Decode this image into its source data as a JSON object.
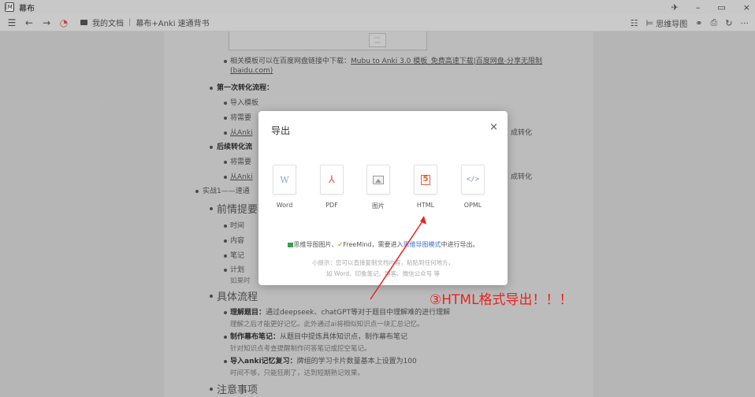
{
  "window": {
    "title": "幕布",
    "app_icon": "[M]",
    "pin": "✈",
    "minimize": "–",
    "maximize": "▭",
    "close": "×"
  },
  "toolbar": {
    "menu": "☰",
    "back": "←",
    "forward": "→",
    "breadcrumb": [
      "我的文档",
      "幕布+Anki 速通背书"
    ],
    "right": {
      "icon1": "☷",
      "mindmap_icon": "⊨",
      "mindmap": "思维导图",
      "share": "⚭",
      "export": "⎙",
      "refresh": "↻",
      "more": "···"
    }
  },
  "doc": {
    "l1": "相关模板可以在百度网盘链接中下载：",
    "l1_link": "Mubu to Anki 3.0 模板_免费高速下载|百度网盘-分享无限制",
    "l1_link2": "(baidu.com)",
    "l2": "第一次转化流程：",
    "l3": "导入模板",
    "l4": "将需要",
    "l5": "从Anki",
    "l5_tail": "成转化",
    "l6": "后续转化流",
    "l7": "将需要",
    "l8": "从Anki",
    "l8_tail": "成转化",
    "l9": "实战1——速通",
    "l10": "前情提要",
    "l11": "时间",
    "l12": "内容",
    "l13": "笔记",
    "l14": "计划",
    "l14b": "如果时",
    "l15": "具体流程",
    "l16_bold": "理解题目：",
    "l16": "通过deepseek、chatGPT等对于题目中理解难的进行理解",
    "l16b": "理解之后才能更好记忆。此外通过ai将相似知识点一块汇总记忆。",
    "l17_bold": "制作幕布笔记：",
    "l17": "从题目中提炼具体知识点，制作幕布笔记",
    "l17b": "针对知识点考查提醒制作问答笔记或挖空笔记。",
    "l18_bold": "导入anki记忆复习：",
    "l18": "牌组的学习卡片数量基本上设置为100",
    "l18b": "时间不够，只能狂刷了，达到短期熟记效果。",
    "l19": "注意事项"
  },
  "modal": {
    "title": "导出",
    "close": "×",
    "formats": [
      {
        "label": "Word",
        "glyph": "W"
      },
      {
        "label": "PDF",
        "glyph": "⅄"
      },
      {
        "label": "图片",
        "glyph": ""
      },
      {
        "label": "HTML",
        "glyph": "5"
      },
      {
        "label": "OPML",
        "glyph": "</>"
      }
    ],
    "note_a": "思维导图图片、",
    "note_fm_icon": "✔",
    "note_b": "FreeMind，需要进入",
    "note_link": "思维导图模式",
    "note_c": "中进行导出。",
    "tip1": "小提示：您可以直接复制文档内容，粘贴到任何地方，",
    "tip2": "如 Word、印象笔记、博客、微信公众号 等"
  },
  "annotation": {
    "text": "③HTML格式导出！！！",
    "color": "#e8231f"
  }
}
